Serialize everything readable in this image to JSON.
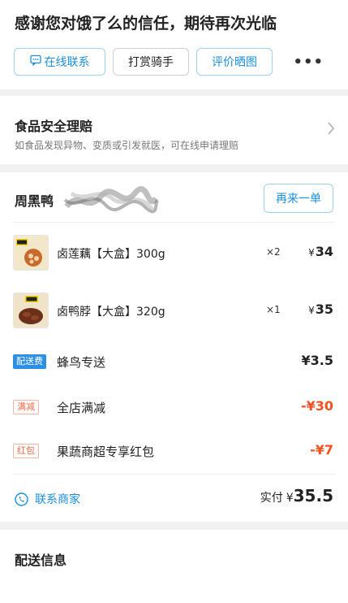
{
  "thanks": {
    "title": "感谢您对饿了么的信任，期待再次光临",
    "chat_label": "在线联系",
    "tip_label": "打赏骑手",
    "review_label": "评价晒图",
    "more_label": "•••"
  },
  "safety": {
    "title": "食品安全理赔",
    "desc": "如食品发现异物、变质或引发就医，可在线申请理赔"
  },
  "order": {
    "shop_name": "周黑鸭",
    "reorder_label": "再来一单",
    "items": [
      {
        "name": "卤莲藕【大盒】300g",
        "qty": "×2",
        "price": "34",
        "currency": "¥"
      },
      {
        "name": "卤鸭脖【大盒】320g",
        "qty": "×1",
        "price": "35",
        "currency": "¥"
      }
    ],
    "fees": [
      {
        "tag": "配送费",
        "label": "蜂鸟专送",
        "value": "¥3.5"
      },
      {
        "tag": "满减",
        "label": "全店满减",
        "value": "-¥30"
      },
      {
        "tag": "红包",
        "label": "果蔬商超专享红包",
        "value": "-¥7"
      }
    ],
    "contact_label": "联系商家",
    "total_label": "实付",
    "total_currency": "¥",
    "total_value": "35.5"
  },
  "delivery": {
    "title": "配送信息"
  },
  "colors": {
    "accent": "#1a8fdc",
    "discount": "#f4511e",
    "tag_blue": "#2d8fe3"
  }
}
